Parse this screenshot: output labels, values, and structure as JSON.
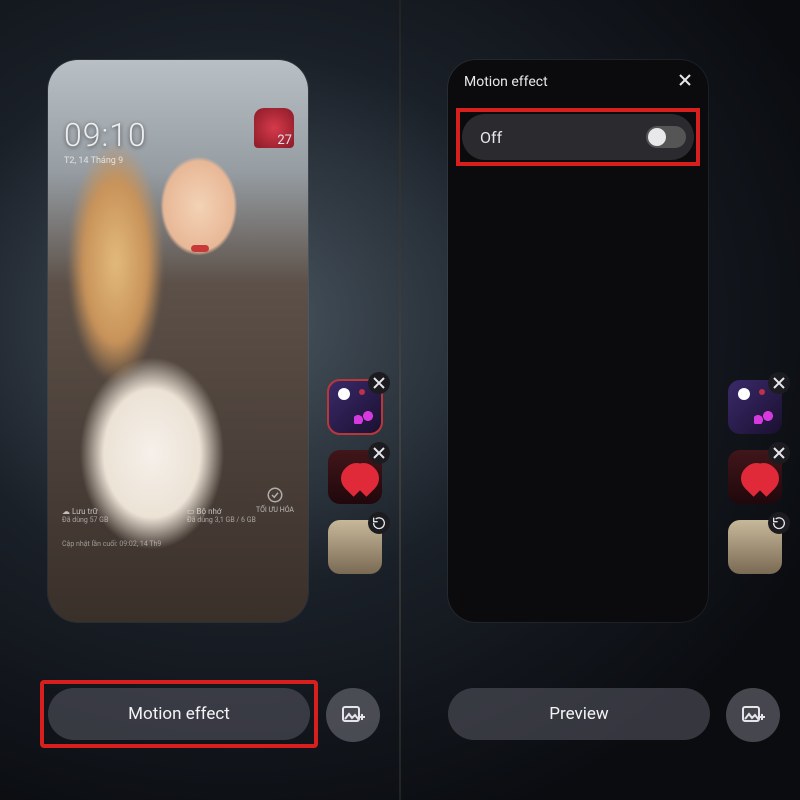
{
  "left": {
    "clock": "09:10",
    "date": "T2, 14 Tháng 9",
    "widget_day": "27",
    "storage": {
      "col1_title": "Lưu trữ",
      "col1_sub": "Đã dùng 57 GB",
      "col1_sub2": "Cập nhật lần cuối: 09:02, 14 Th9",
      "col2_title": "Bộ nhớ",
      "col2_sub": "Đã dùng 3,1 GB / 6 GB"
    },
    "optimize_label": "TỐI ƯU HÓA",
    "pill_label": "Motion effect"
  },
  "right": {
    "sheet_title": "Motion effect",
    "toggle_label": "Off",
    "pill_label": "Preview"
  },
  "icons": {
    "close": "close-icon",
    "refresh": "refresh-icon",
    "add_image": "add-image-icon"
  }
}
